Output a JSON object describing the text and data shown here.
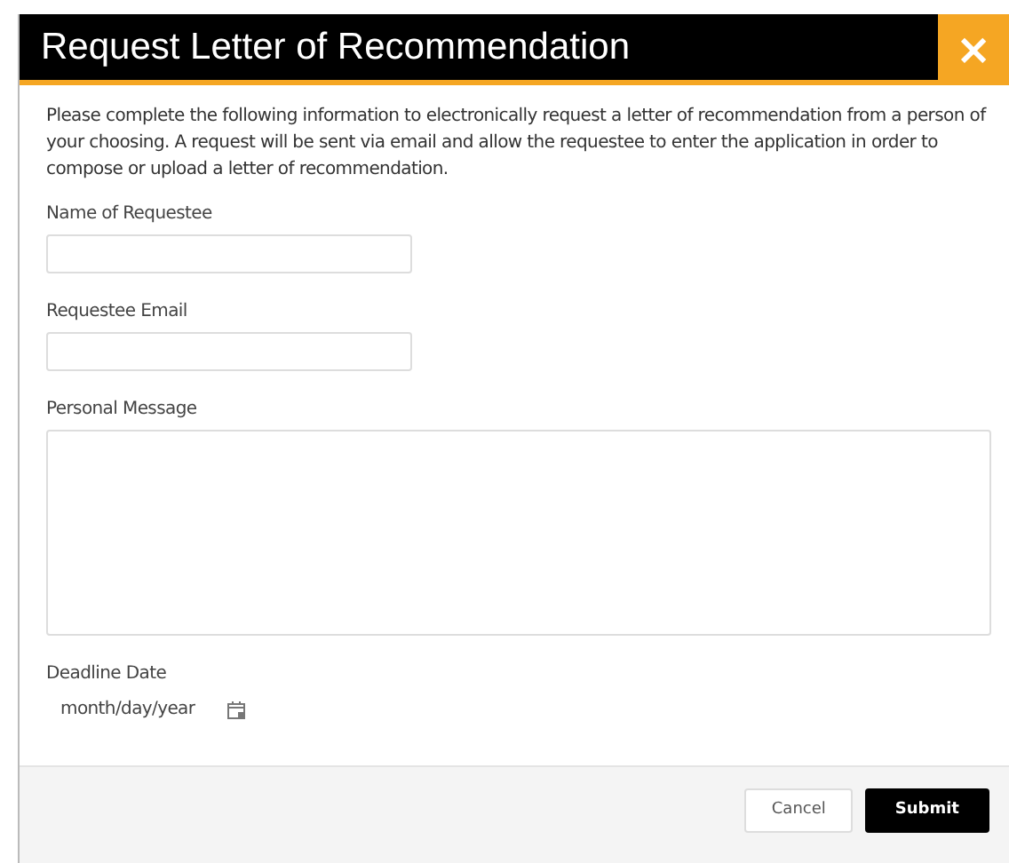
{
  "dialog": {
    "title": "Request Letter of Recommendation",
    "close_icon": "×"
  },
  "intro": "Please complete the following information to electronically request a letter of recommendation from a person of your choosing. A request will be sent via email and allow the requestee to enter the application in order to compose or upload a letter of recommendation.",
  "fields": [
    {
      "kind": "text",
      "label": "Name of Requestee"
    },
    {
      "kind": "text",
      "label": "Requestee Email"
    },
    {
      "kind": "textarea",
      "label": "Personal Message"
    },
    {
      "kind": "date",
      "label": "Deadline Date",
      "placeholder": "month/day/year"
    }
  ],
  "buttons": [
    {
      "label": "Cancel",
      "kind": "secondary"
    },
    {
      "label": "Submit",
      "kind": "primary"
    }
  ]
}
